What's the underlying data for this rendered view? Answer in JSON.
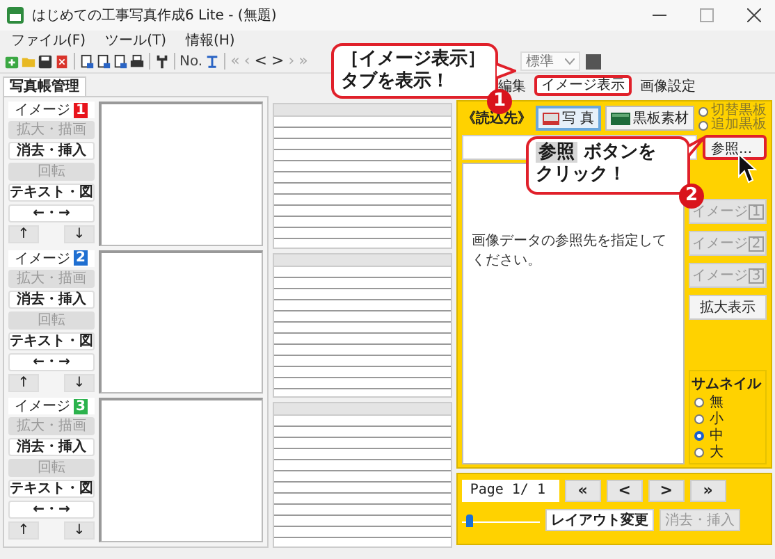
{
  "window": {
    "title": "はじめての工事写真作成6 Lite - (無題)"
  },
  "menu": [
    "ファイル(F)",
    "ツール(T)",
    "情報(H)"
  ],
  "toolbar": [
    {
      "kind": "new"
    },
    {
      "kind": "open"
    },
    {
      "kind": "save"
    },
    {
      "kind": "delete"
    },
    {
      "kind": "sep"
    },
    {
      "kind": "page"
    },
    {
      "kind": "page"
    },
    {
      "kind": "page"
    },
    {
      "kind": "print"
    },
    {
      "kind": "sep"
    },
    {
      "kind": "wrench"
    },
    {
      "kind": "sep"
    },
    {
      "kind": "text",
      "label": "No."
    },
    {
      "kind": "tool"
    },
    {
      "kind": "sep"
    },
    {
      "kind": "nav",
      "label": "«",
      "disabled": true
    },
    {
      "kind": "nav",
      "label": "‹",
      "disabled": true
    },
    {
      "kind": "nav",
      "label": "<",
      "disabled": false
    },
    {
      "kind": "nav",
      "label": ">",
      "disabled": false
    },
    {
      "kind": "nav",
      "label": "›",
      "disabled": true
    },
    {
      "kind": "nav",
      "label": "»",
      "disabled": true
    }
  ],
  "style_select": {
    "value": "標準"
  },
  "panel_tab": "写真帳管理",
  "images": [
    {
      "label": "イメージ",
      "number": "1",
      "color": "#e8141c",
      "buttons": [
        {
          "label": "拡大・描画",
          "disabled": true
        },
        {
          "label": "消去・挿入",
          "disabled": false
        },
        {
          "label": "回転",
          "disabled": true
        },
        {
          "label": "テキスト・図",
          "disabled": false
        },
        {
          "label": "←・→",
          "disabled": false
        }
      ],
      "up": "↑",
      "down": "↓"
    },
    {
      "label": "イメージ",
      "number": "2",
      "color": "#1f6fd1",
      "buttons": [
        {
          "label": "拡大・描画",
          "disabled": true
        },
        {
          "label": "消去・挿入",
          "disabled": false
        },
        {
          "label": "回転",
          "disabled": true
        },
        {
          "label": "テキスト・図",
          "disabled": false
        },
        {
          "label": "←・→",
          "disabled": false
        }
      ],
      "up": "↑",
      "down": "↓"
    },
    {
      "label": "イメージ",
      "number": "3",
      "color": "#2bb24c",
      "buttons": [
        {
          "label": "拡大・描画",
          "disabled": true
        },
        {
          "label": "消去・挿入",
          "disabled": false
        },
        {
          "label": "回転",
          "disabled": true
        },
        {
          "label": "テキスト・図",
          "disabled": false
        },
        {
          "label": "←・→",
          "disabled": false
        }
      ],
      "up": "↑",
      "down": "↓"
    }
  ],
  "view_tabs": [
    {
      "label": "編集",
      "selected": false,
      "highlighted": false
    },
    {
      "label": "イメージ表示",
      "selected": true,
      "highlighted": true
    },
    {
      "label": "画像設定",
      "selected": false,
      "highlighted": false
    }
  ],
  "source": {
    "label": "《読込先》",
    "buttons": [
      {
        "label": "写 真",
        "kind": "photo",
        "selected": true
      },
      {
        "label": "黒板素材",
        "kind": "board",
        "selected": false
      }
    ],
    "options": [
      {
        "label": "切替黒板",
        "selected": false,
        "disabled": true
      },
      {
        "label": "追加黒板",
        "selected": false,
        "disabled": true
      }
    ]
  },
  "browse_button": {
    "label": "参照...",
    "highlighted": true
  },
  "hint": "画像データの参照先を指定してください。",
  "side_buttons": [
    {
      "label": "イメージ",
      "number": "1",
      "disabled": true
    },
    {
      "label": "イメージ",
      "number": "2",
      "disabled": true
    },
    {
      "label": "イメージ",
      "number": "3",
      "disabled": true
    },
    {
      "label": "拡大表示",
      "disabled": false
    }
  ],
  "thumbnail": {
    "title": "サムネイル",
    "options": [
      {
        "label": "無",
        "selected": false
      },
      {
        "label": "小",
        "selected": false
      },
      {
        "label": "中",
        "selected": true
      },
      {
        "label": "大",
        "selected": false
      }
    ]
  },
  "pager": {
    "page": "Page 1/ 1",
    "nav": [
      "«",
      "<",
      ">",
      "»"
    ],
    "level": 0.05,
    "buttons": [
      {
        "label": "レイアウト変更",
        "disabled": false
      },
      {
        "label": "消去・挿入",
        "disabled": true
      }
    ]
  },
  "callouts": [
    {
      "number": "1",
      "lines": [
        "［イメージ表示］",
        "タブを表示！"
      ]
    },
    {
      "number": "2",
      "highlight": "参照",
      "lines": [
        "ボタンを",
        "クリック！"
      ]
    }
  ]
}
